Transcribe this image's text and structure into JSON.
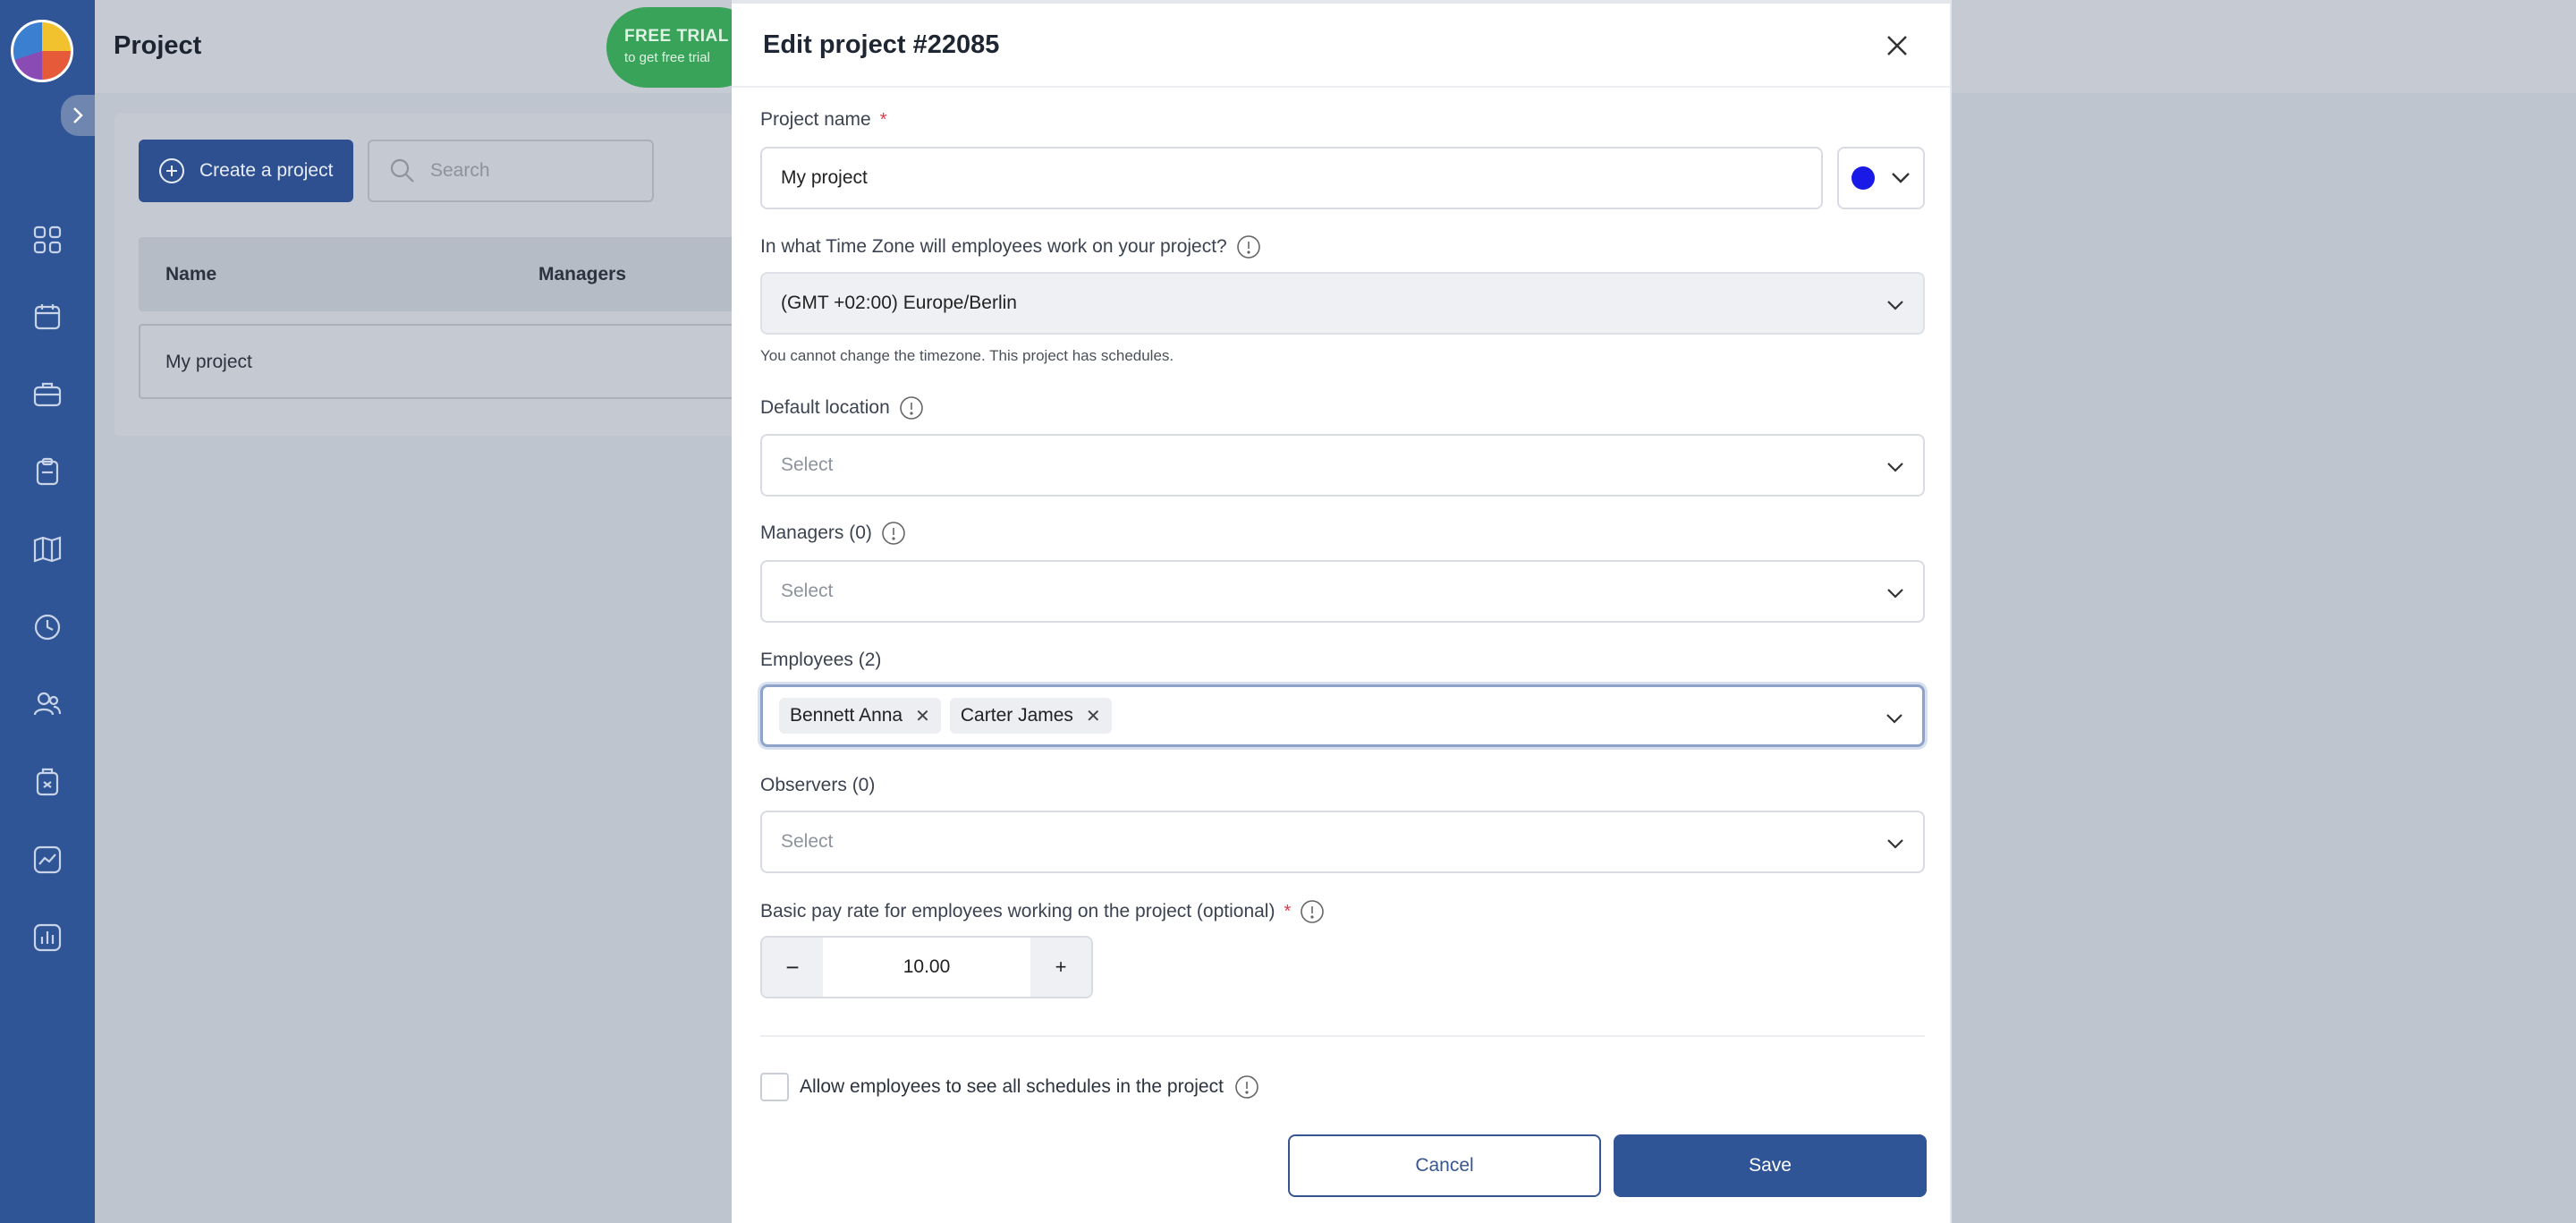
{
  "app": {
    "page_title": "Project",
    "trial": {
      "line1": "FREE TRIAL",
      "line2": "to get free trial"
    },
    "toolbar": {
      "create_label": "Create a project",
      "search_placeholder": "Search"
    },
    "table": {
      "headers": [
        "Name",
        "Managers"
      ],
      "rows": [
        {
          "name": "My project"
        }
      ]
    },
    "sidebar_icons": [
      "dashboard-icon",
      "calendar-icon",
      "briefcase-icon",
      "clipboard-icon",
      "map-icon",
      "clock-icon",
      "users-icon",
      "badge-icon",
      "chart-icon",
      "reports-icon"
    ]
  },
  "panel": {
    "title": "Edit project #22085",
    "project_name": {
      "label": "Project name",
      "required": "*",
      "value": "My project",
      "color": "#1a1ae6"
    },
    "timezone": {
      "label": "In what Time Zone will employees work on your project?",
      "value": "(GMT +02:00) Europe/Berlin",
      "hint": "You cannot change the timezone. This project has schedules."
    },
    "location": {
      "label": "Default location",
      "placeholder": "Select"
    },
    "managers": {
      "label": "Managers (0)",
      "placeholder": "Select"
    },
    "employees": {
      "label": "Employees (2)",
      "chips": [
        "Bennett Anna",
        "Carter James"
      ]
    },
    "observers": {
      "label": "Observers (0)",
      "placeholder": "Select"
    },
    "pay_rate": {
      "label": "Basic pay rate for employees working on the project (optional)",
      "required": "*",
      "value": "10.00",
      "minus": "−",
      "plus": "+"
    },
    "allow_schedules": {
      "label": "Allow employees to see all schedules in the project",
      "checked": false
    },
    "buttons": {
      "cancel": "Cancel",
      "save": "Save"
    }
  }
}
